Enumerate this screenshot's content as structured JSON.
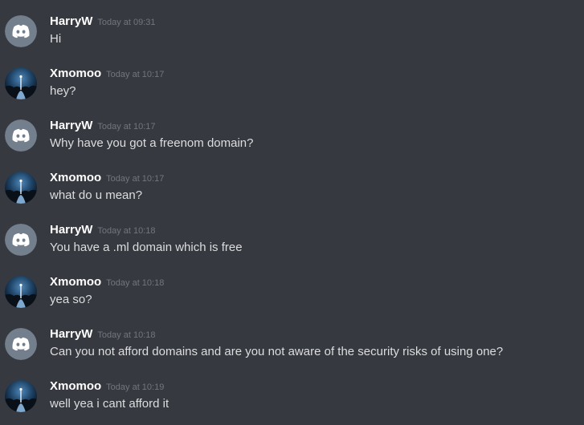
{
  "users": {
    "harry": {
      "name": "HarryW",
      "avatar_icon": "discord-logo-icon",
      "avatar_color": "#747f8d"
    },
    "xmomoo": {
      "name": "Xmomoo",
      "avatar_icon": "night-landscape-icon",
      "avatar_color": "#1c3a57"
    }
  },
  "messages": [
    {
      "author": "HarryW",
      "time": "Today at 09:31",
      "text": "Hi"
    },
    {
      "author": "Xmomoo",
      "time": "Today at 10:17",
      "text": "hey?"
    },
    {
      "author": "HarryW",
      "time": "Today at 10:17",
      "text": "Why have you got a freenom domain?"
    },
    {
      "author": "Xmomoo",
      "time": "Today at 10:17",
      "text": "what do u mean?"
    },
    {
      "author": "HarryW",
      "time": "Today at 10:18",
      "text": "You have a .ml domain which is free"
    },
    {
      "author": "Xmomoo",
      "time": "Today at 10:18",
      "text": "yea so?"
    },
    {
      "author": "HarryW",
      "time": "Today at 10:18",
      "text": "Can you not afford domains and are you not aware of the security risks of using one?"
    },
    {
      "author": "Xmomoo",
      "time": "Today at 10:19",
      "text": "well yea i cant afford it"
    }
  ]
}
